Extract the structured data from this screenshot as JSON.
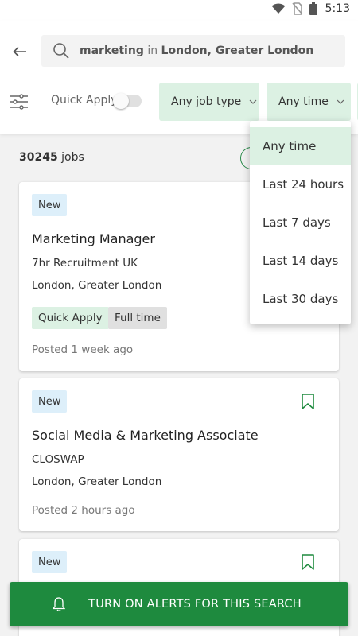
{
  "status_bar": {
    "time": "5:13"
  },
  "search": {
    "keyword": "marketing",
    "connector": "in",
    "location": "London, Greater London"
  },
  "filters": {
    "quick_apply_label": "Quick Apply",
    "quick_apply_on": false,
    "job_type_label": "Any job type",
    "time_label": "Any time"
  },
  "results": {
    "count": "30245",
    "count_suffix": "jobs"
  },
  "time_dropdown": {
    "options": [
      "Any time",
      "Last 24 hours",
      "Last 7 days",
      "Last 14 days",
      "Last 30 days"
    ],
    "selected": "Any time"
  },
  "jobs": [
    {
      "badge": "New",
      "title": "Marketing Manager",
      "company": "7hr Recruitment UK",
      "location": "London, Greater London",
      "tags": [
        "Quick Apply",
        "Full time"
      ],
      "posted": "Posted 1 week ago"
    },
    {
      "badge": "New",
      "title": "Social Media & Marketing Associate",
      "company": "CLOSWAP",
      "location": "London, Greater London",
      "posted": "Posted 2 hours ago"
    },
    {
      "badge": "New"
    }
  ],
  "alert_button": {
    "label": "TURN ON ALERTS FOR THIS SEARCH"
  },
  "colors": {
    "accent": "#1e8a3e",
    "chip_bg": "#dcf1e3",
    "badge_bg": "#ddeffa"
  }
}
